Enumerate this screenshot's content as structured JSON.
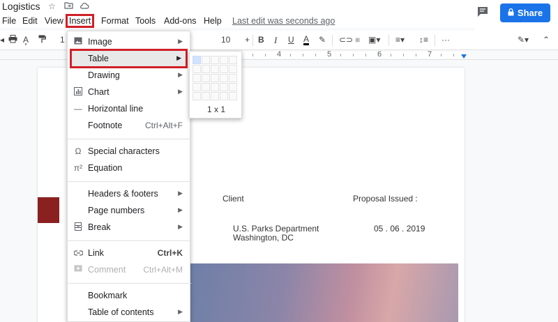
{
  "title_bar": {
    "document_title": "Logistics",
    "icons": [
      "star-icon",
      "folder-move-icon",
      "cloud-status-icon"
    ],
    "share_label": "Share",
    "share_color": "#1a73e8"
  },
  "menu_bar": {
    "items": [
      "File",
      "Edit",
      "View",
      "Insert",
      "Format",
      "Tools",
      "Add-ons",
      "Help"
    ],
    "last_edit": "Last edit was seconds ago"
  },
  "toolbar": {
    "font_size": "10",
    "bold": "B",
    "italic": "I",
    "underline": "U",
    "text_color": "A"
  },
  "ruler": {
    "labels": [
      "4",
      "5",
      "6",
      "7"
    ]
  },
  "document": {
    "client_header": "Client",
    "proposal_header": "Proposal Issued :",
    "client_name": "U.S. Parks Department",
    "client_location": "Washington, DC",
    "proposal_date": "05 . 06 . 2019"
  },
  "insert_menu": {
    "items": [
      {
        "label": "Image",
        "icon": "image-icon",
        "submenu": true
      },
      {
        "label": "Table",
        "icon": "",
        "submenu": true
      },
      {
        "label": "Drawing",
        "icon": "",
        "submenu": true
      },
      {
        "label": "Chart",
        "icon": "chart-icon",
        "submenu": true
      },
      {
        "label": "Horizontal line",
        "icon": "horizontal-line-icon",
        "submenu": false
      },
      {
        "label": "Footnote",
        "icon": "",
        "shortcut": "Ctrl+Alt+F"
      },
      {
        "label": "Special characters",
        "icon": "omega-icon",
        "submenu": false
      },
      {
        "label": "Equation",
        "icon": "pi-icon",
        "submenu": false
      },
      {
        "label": "Headers & footers",
        "icon": "",
        "submenu": true
      },
      {
        "label": "Page numbers",
        "icon": "",
        "submenu": true
      },
      {
        "label": "Break",
        "icon": "page-break-icon",
        "submenu": true
      },
      {
        "label": "Link",
        "icon": "link-icon",
        "shortcut": "Ctrl+K"
      },
      {
        "label": "Comment",
        "icon": "comment-add-icon",
        "shortcut": "Ctrl+Alt+M",
        "disabled": true
      },
      {
        "label": "Bookmark",
        "icon": "",
        "submenu": false
      },
      {
        "label": "Table of contents",
        "icon": "",
        "submenu": true
      }
    ],
    "highlight_color": "#d11f26"
  },
  "table_grid": {
    "size_label": "1 x 1",
    "selected_rows": 1,
    "selected_cols": 1
  }
}
